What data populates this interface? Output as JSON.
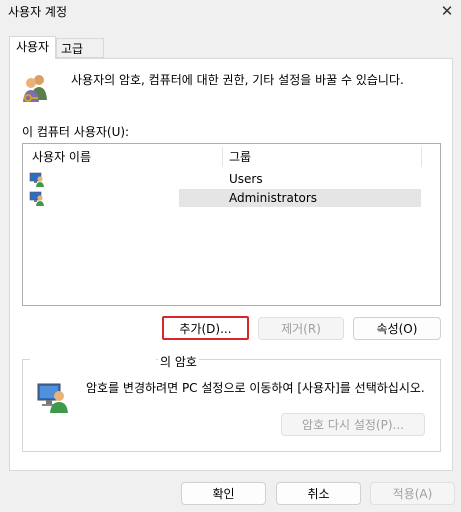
{
  "window": {
    "title": "사용자 계정",
    "close_glyph": "✕"
  },
  "tabs": [
    {
      "label": "사용자",
      "active": true
    },
    {
      "label": "고급",
      "active": false
    }
  ],
  "description": "사용자의 암호, 컴퓨터에 대한 권한, 기타 설정을 바꿀 수 있습니다.",
  "users_list": {
    "label": "이 컴퓨터 사용자(U):",
    "columns": [
      "사용자 이름",
      "그룹"
    ],
    "rows": [
      {
        "name": "",
        "group": "Users",
        "icon": "user-icon"
      },
      {
        "name": "",
        "group": "Administrators",
        "icon": "user-icon",
        "selected": true
      }
    ]
  },
  "buttons": {
    "add": "추가(D)...",
    "remove": "제거(R)",
    "properties": "속성(O)"
  },
  "password_group": {
    "title": "의 암호",
    "description": "암호를 변경하려면 PC 설정으로 이동하여 [사용자]를 선택하십시오.",
    "reset_button": "암호 다시 설정(P)..."
  },
  "footer": {
    "ok": "확인",
    "cancel": "취소",
    "apply": "적용(A)"
  },
  "colors": {
    "highlight_border": "#d8262a",
    "selected_row": "#e5e5e5"
  }
}
